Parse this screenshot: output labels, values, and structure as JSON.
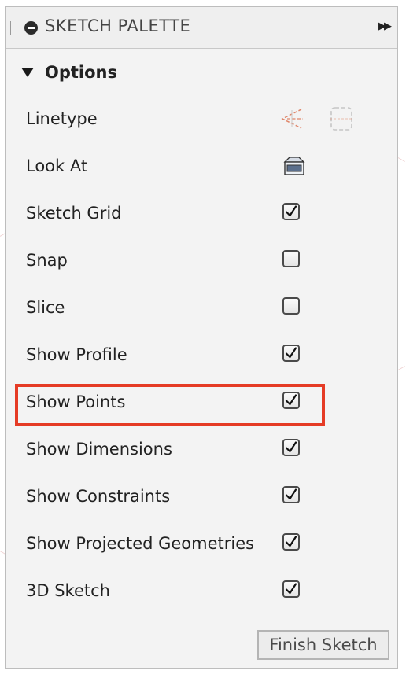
{
  "header": {
    "title": "SKETCH PALETTE",
    "grip_icon": "drag-grip-icon",
    "close_icon": "minus-circle-icon",
    "expand_icon": "double-arrow-right-icon"
  },
  "section": {
    "title": "Options",
    "icon": "triangle-down-icon"
  },
  "rows": [
    {
      "label": "Linetype",
      "control": "linetype-icons"
    },
    {
      "label": "Look At",
      "control": "look-at-icon"
    },
    {
      "label": "Sketch Grid",
      "checked": true
    },
    {
      "label": "Snap",
      "checked": false
    },
    {
      "label": "Slice",
      "checked": false
    },
    {
      "label": "Show Profile",
      "checked": true
    },
    {
      "label": "Show Points",
      "checked": true
    },
    {
      "label": "Show Dimensions",
      "checked": true
    },
    {
      "label": "Show Constraints",
      "checked": true
    },
    {
      "label": "Show Projected Geometries",
      "checked": true
    },
    {
      "label": "3D Sketch",
      "checked": true
    }
  ],
  "footer": {
    "finish_label": "Finish Sketch"
  },
  "colors": {
    "highlight": "#e53b25",
    "linetype_accent": "#e0866a",
    "panel_bg": "#f3f3f3"
  }
}
